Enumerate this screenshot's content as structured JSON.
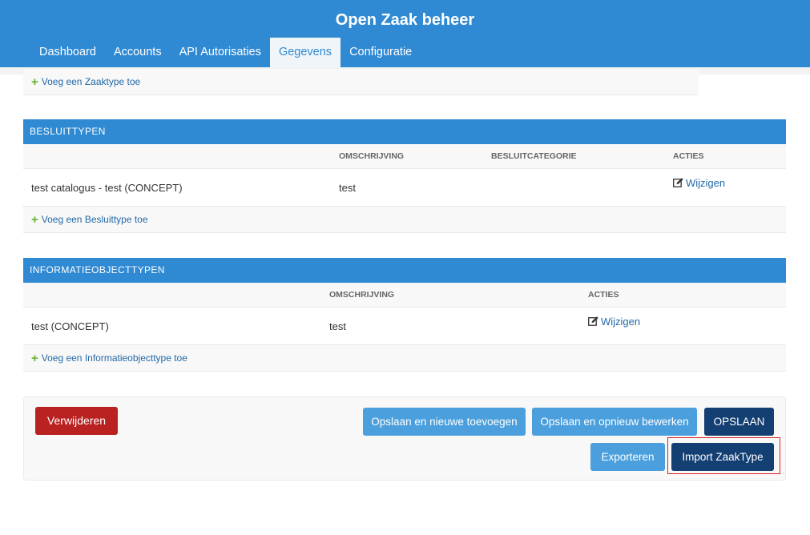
{
  "header": {
    "title": "Open Zaak beheer",
    "nav": [
      {
        "label": "Dashboard",
        "active": false
      },
      {
        "label": "Accounts",
        "active": false
      },
      {
        "label": "API Autorisaties",
        "active": false
      },
      {
        "label": "Gegevens",
        "active": true
      },
      {
        "label": "Configuratie",
        "active": false
      }
    ]
  },
  "zaaktypen": {
    "add_label": "Voeg een Zaaktype toe"
  },
  "besluittypen": {
    "caption": "BESLUITTYPEN",
    "columns": {
      "omschrijving": "OMSCHRIJVING",
      "categorie": "BESLUITCATEGORIE",
      "acties": "ACTIES"
    },
    "rows": [
      {
        "name": "test catalogus - test (CONCEPT)",
        "omschrijving": "test",
        "categorie": "",
        "action": "Wijzigen"
      }
    ],
    "add_label": "Voeg een Besluittype toe"
  },
  "informatieobjecttypen": {
    "caption": "INFORMATIEOBJECTTYPEN",
    "columns": {
      "omschrijving": "OMSCHRIJVING",
      "acties": "ACTIES"
    },
    "rows": [
      {
        "name": "test (CONCEPT)",
        "omschrijving": "test",
        "action": "Wijzigen"
      }
    ],
    "add_label": "Voeg een Informatieobjecttype toe"
  },
  "submit": {
    "delete": "Verwijderen",
    "save_add": "Opslaan en nieuwe toevoegen",
    "save_continue": "Opslaan en opnieuw bewerken",
    "save": "OPSLAAN",
    "export": "Exporteren",
    "import": "Import ZaakType"
  },
  "icons": {
    "add": "plus-icon",
    "edit": "edit-icon"
  },
  "colors": {
    "primary": "#2f8ad3",
    "dark_button": "#143f73",
    "delete": "#ba2121",
    "add_plus": "#62b131",
    "link": "#2369a8",
    "highlight": "#e02020"
  }
}
